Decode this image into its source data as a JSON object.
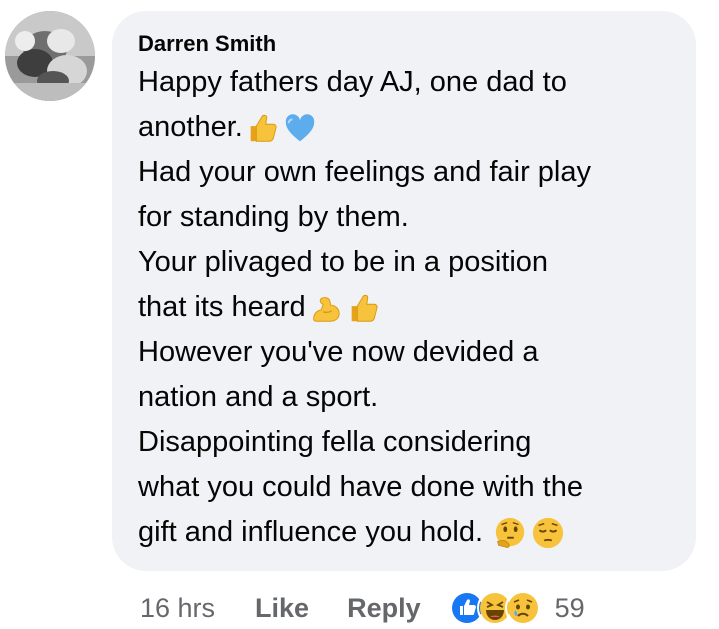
{
  "comment": {
    "author": "Darren Smith",
    "lines": [
      {
        "text": "Happy fathers day AJ, one dad to",
        "emojis": []
      },
      {
        "text": "another.",
        "emojis": [
          "thumbs-up-emoji",
          "blue-heart-emoji"
        ]
      },
      {
        "text": "Had your own feelings and fair play",
        "emojis": []
      },
      {
        "text": "for standing by them.",
        "emojis": []
      },
      {
        "text": "Your plivaged to be in a position",
        "emojis": []
      },
      {
        "text": "that its heard",
        "emojis": [
          "flexed-biceps-emoji",
          "thumbs-up-emoji"
        ]
      },
      {
        "text": "However you've now devided a",
        "emojis": []
      },
      {
        "text": "nation and a sport.",
        "emojis": []
      },
      {
        "text": "Disappointing fella considering",
        "emojis": []
      },
      {
        "text": "what you could have done with the",
        "emojis": []
      },
      {
        "text": "gift and influence you hold. ",
        "emojis": [
          "thinking-face-emoji",
          "pensive-face-emoji"
        ]
      }
    ]
  },
  "actions": {
    "timestamp": "16 hrs",
    "like_label": "Like",
    "reply_label": "Reply",
    "reaction_icons": [
      "like-reaction-icon",
      "haha-reaction-icon",
      "sad-reaction-icon"
    ],
    "reaction_count": "59"
  },
  "colors": {
    "bubble_bg": "#f0f2f5",
    "text": "#050505",
    "secondary_text": "#65676b",
    "like_blue": "#1877f2",
    "emoji_yellow": "#f7c33c"
  }
}
